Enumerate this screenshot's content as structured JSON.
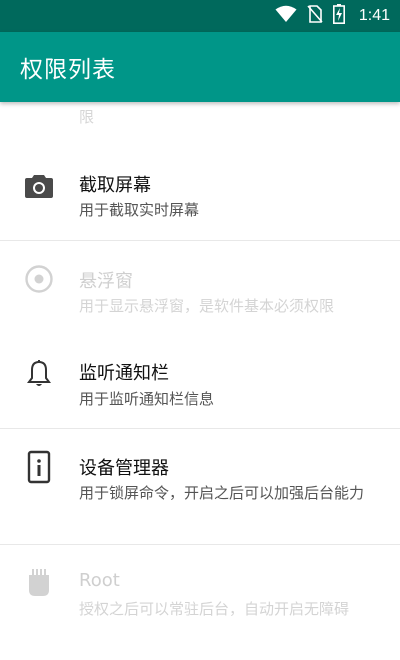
{
  "status_bar": {
    "time": "1:41",
    "icons": [
      "wifi-icon",
      "no-sim-icon",
      "battery-charging-icon"
    ]
  },
  "app_bar": {
    "title": "权限列表",
    "color": "#009688"
  },
  "list": {
    "partial_text": "限",
    "items": [
      {
        "icon": "camera-icon",
        "title": "截取屏幕",
        "desc": "用于截取实时屏幕",
        "enabled": true
      },
      {
        "icon": "radio-target-icon",
        "title": "悬浮窗",
        "desc": "用于显示悬浮窗，是软件基本必须权限",
        "enabled": false
      },
      {
        "icon": "bell-icon",
        "title": "监听通知栏",
        "desc": "用于监听通知栏信息",
        "enabled": true
      },
      {
        "icon": "device-info-icon",
        "title": "设备管理器",
        "desc": "用于锁屏命令，开启之后可以加强后台能力",
        "enabled": true
      },
      {
        "icon": "root-chip-icon",
        "title": "Root",
        "desc": "授权之后可以常驻后台，自动开启无障碍",
        "enabled": false
      }
    ]
  }
}
